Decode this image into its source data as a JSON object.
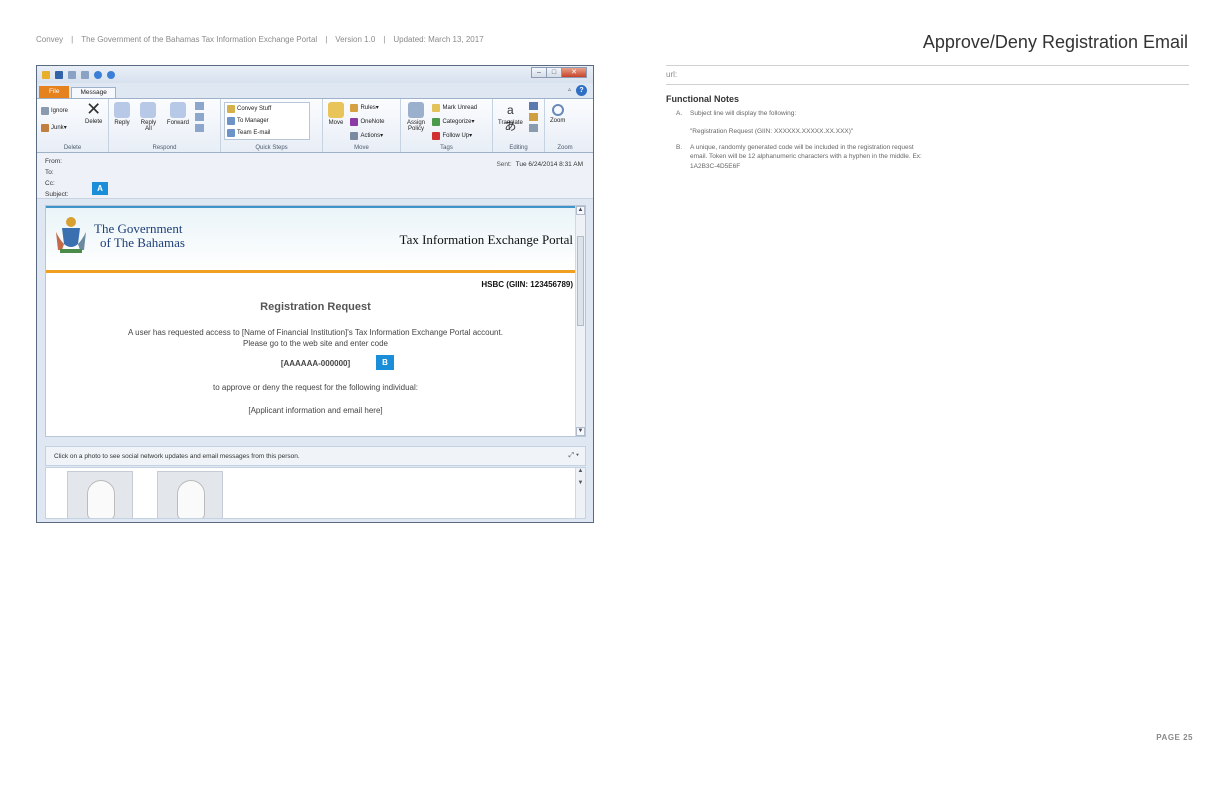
{
  "doc_header": {
    "brand": "Convey",
    "portal": "The Government of the Bahamas Tax Information Exchange Portal",
    "version": "Version 1.0",
    "updated": "Updated: March 13, 2017"
  },
  "page_heading": "Approve/Deny Registration Email",
  "url_label": "url:",
  "functional_notes": {
    "title": "Functional Notes",
    "notes": [
      {
        "label": "A.",
        "text": "Subject line will display the following:",
        "sub": "\"Registration Request (GIIN: XXXXXX.XXXXX.XX.XXX)\""
      },
      {
        "label": "B.",
        "text": "A unique, randomly generated code will be included in the registration request email. Token will be 12 alphanumeric characters with a hyphen in the middle. Ex: 1A2B3C-4D5E6F"
      }
    ]
  },
  "page_number": "PAGE 25",
  "outlook": {
    "tabs": {
      "file": "File",
      "message": "Message"
    },
    "ribbon": {
      "delete_group": {
        "ignore": "Ignore",
        "junk": "Junk",
        "delete": "Delete",
        "name": "Delete"
      },
      "respond_group": {
        "reply": "Reply",
        "reply_all": "Reply All",
        "forward": "Forward",
        "name": "Respond"
      },
      "quick_steps": {
        "items": [
          "Convey Stuff",
          "To Manager",
          "Team E-mail"
        ],
        "name": "Quick Steps"
      },
      "move_group": {
        "move": "Move",
        "rules": "Rules",
        "onenote": "OneNote",
        "actions": "Actions",
        "name": "Move"
      },
      "tags_group": {
        "assign_policy": "Assign Policy",
        "mark_unread": "Mark Unread",
        "categorize": "Categorize",
        "follow_up": "Follow Up",
        "name": "Tags"
      },
      "editing_group": {
        "translate": "Translate",
        "name": "Editing"
      },
      "zoom_group": {
        "zoom": "Zoom",
        "name": "Zoom"
      }
    },
    "header_fields": {
      "from": "From:",
      "to": "To:",
      "cc": "Cc:",
      "subject": "Subject:",
      "sent_label": "Sent:",
      "sent_value": "Tue 6/24/2014 8:31 AM"
    },
    "markers": {
      "a": "A",
      "b": "B"
    },
    "email": {
      "gov_line1": "The Government",
      "gov_line2": "of The Bahamas",
      "portal_title": "Tax Information Exchange Portal",
      "institution": "HSBC (GIIN: 123456789)",
      "heading": "Registration Request",
      "message_line1": "A user has requested access to [Name of Financial Institution]'s Tax Information Exchange Portal account.",
      "message_line2": "Please go to the web site and enter code",
      "code": "[AAAAAA-000000]",
      "approve_text": "to approve or deny the request for the following individual:",
      "applicant": "[Applicant information and email here]"
    },
    "social_text": "Click on a photo to see social network updates and email messages from this person."
  }
}
